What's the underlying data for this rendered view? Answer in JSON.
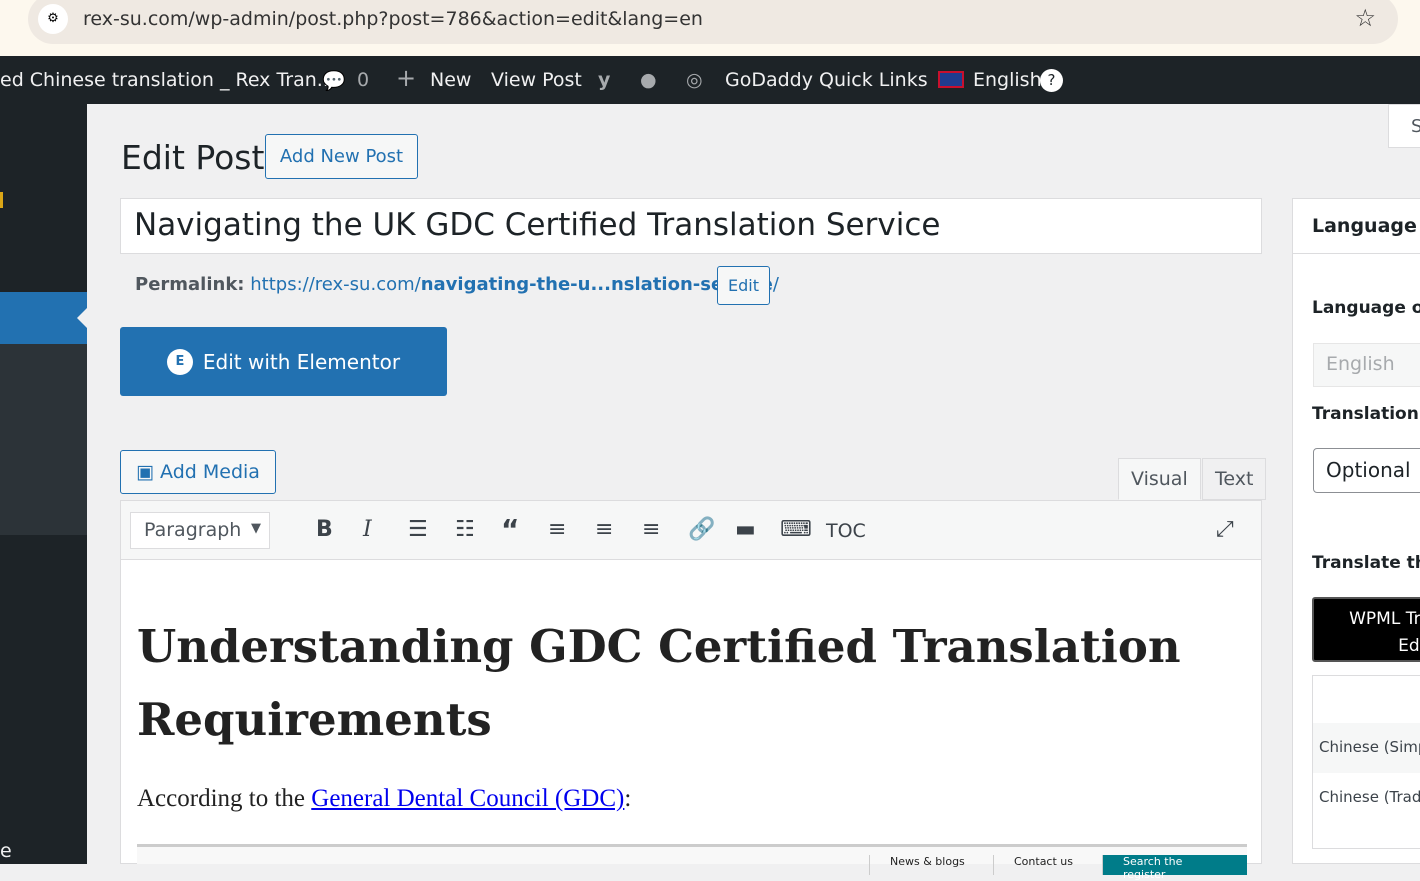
{
  "browser": {
    "url": "rex-su.com/wp-admin/post.php?post=786&action=edit&lang=en"
  },
  "adminbar": {
    "site": "ed Chinese translation _ Rex Tran...",
    "comments": "0",
    "new": "New",
    "view_post": "View Post",
    "godaddy": "GoDaddy Quick Links",
    "language": "English"
  },
  "sidebar": {
    "bottom_text": "e"
  },
  "page": {
    "title": "Edit Post",
    "add_new": "Add New Post",
    "screen_options": "S"
  },
  "post": {
    "title": "Navigating the UK GDC Certified Translation Service",
    "permalink_label": "Permalink:",
    "permalink_base": "https://rex-su.com/",
    "permalink_slug": "navigating-the-u...nslation-service",
    "permalink_end": "/",
    "edit": "Edit"
  },
  "elementor": {
    "label": "Edit with Elementor"
  },
  "editor": {
    "add_media": "Add Media",
    "tab_visual": "Visual",
    "tab_text": "Text",
    "format": "Paragraph",
    "toc": "TOC",
    "heading": "Understanding GDC Certified Translation Requirements",
    "para_prefix": "According to the ",
    "para_link": "General Dental Council (GDC)",
    "para_suffix": ":",
    "embed_tabs": [
      "News & blogs",
      "Contact us",
      "Search the register"
    ]
  },
  "language_panel": {
    "title": "Language",
    "language_of": "Language of",
    "language_value": "English",
    "translation_priority": "Translation P",
    "priority_value": "Optional",
    "translate_this": "Translate this",
    "wpml_line1": "WPML Tra",
    "wpml_line2": "Edit",
    "languages": [
      "Chinese (Simp",
      "Chinese (Tradi"
    ]
  }
}
